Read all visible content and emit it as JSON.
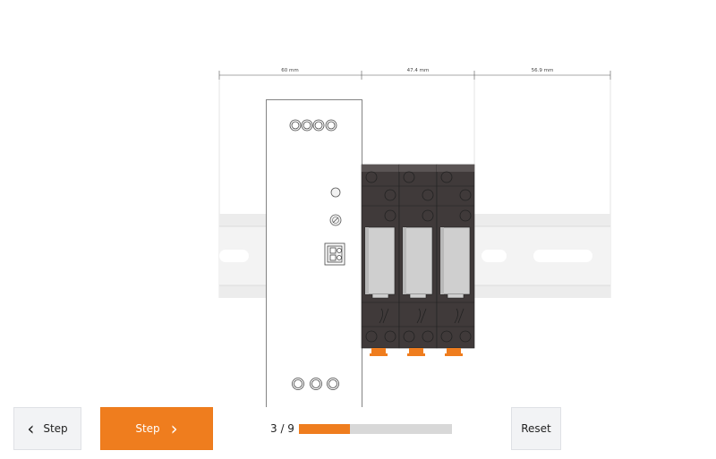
{
  "dimensions": {
    "left_gap": "60 mm",
    "module_width": "47.4 mm",
    "right_gap": "56.9 mm"
  },
  "controls": {
    "prev_label": "Step",
    "next_label": "Step",
    "reset_label": "Reset",
    "prev_icon": "chevron-left-icon",
    "next_icon": "chevron-right-icon"
  },
  "progress": {
    "label": "3 / 9",
    "current_step": 3,
    "total_steps": 9
  },
  "colors": {
    "accent": "#ef7d1e",
    "module_body": "#3f3a3a",
    "window_gray": "#c9c9c9",
    "rail": "#f0f0f0"
  }
}
